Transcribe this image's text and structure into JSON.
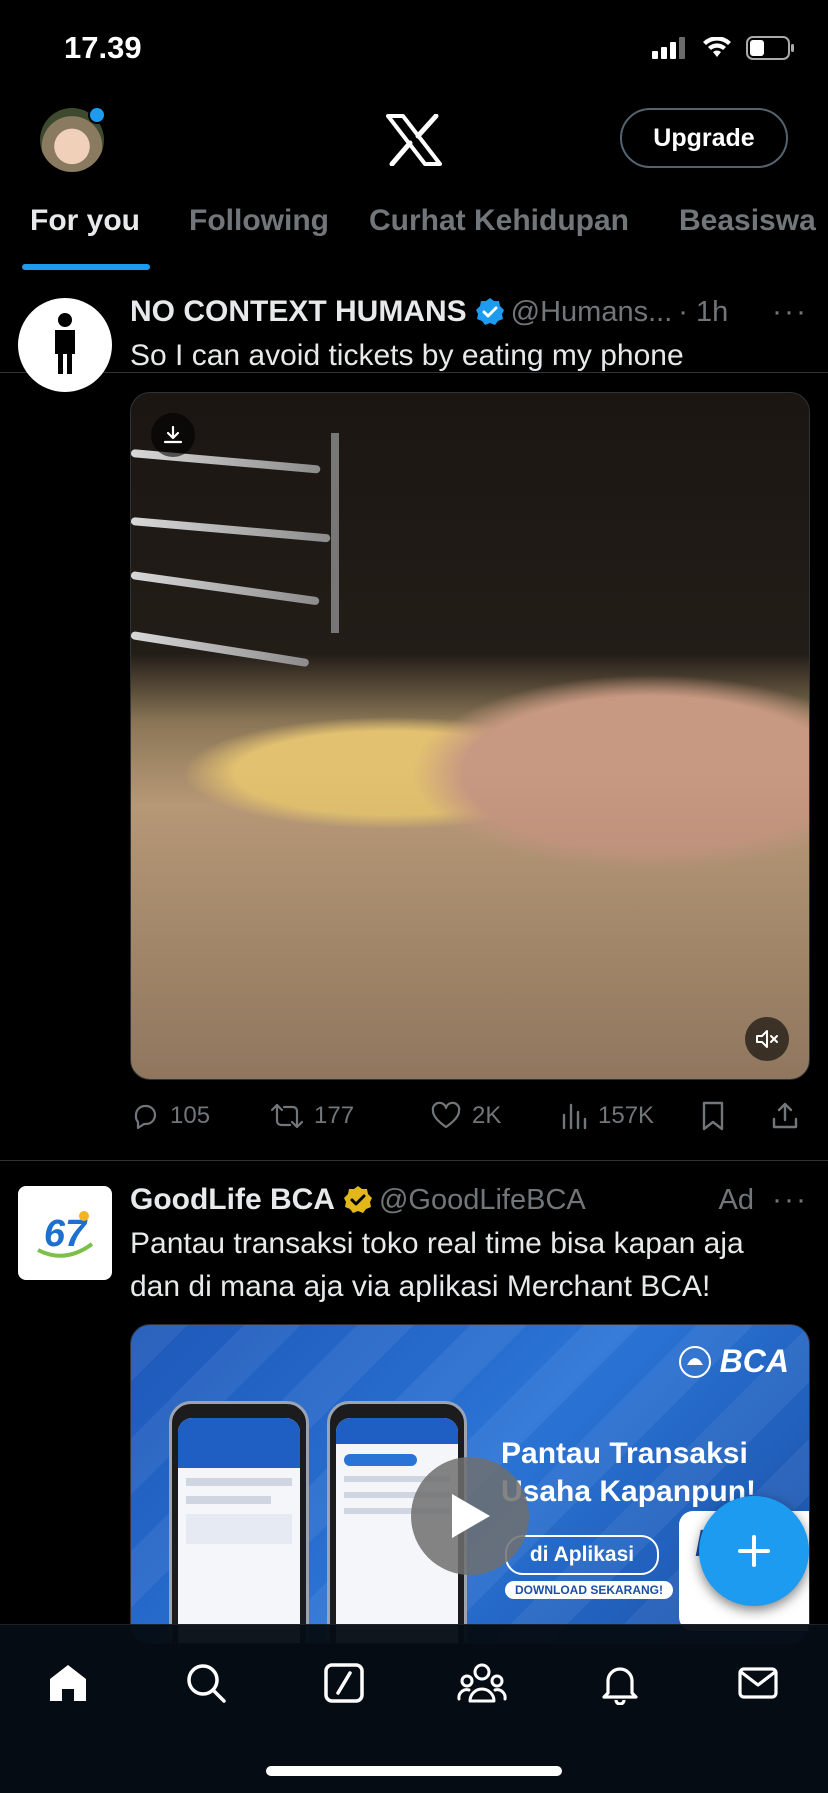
{
  "status_bar": {
    "time": "17.39"
  },
  "header": {
    "upgrade_label": "Upgrade"
  },
  "tabs": [
    {
      "label": "For you",
      "active": true
    },
    {
      "label": "Following"
    },
    {
      "label": "Curhat Kehidupan"
    },
    {
      "label": "Beasiswa"
    }
  ],
  "tweets": [
    {
      "name": "NO CONTEXT HUMANS",
      "handle": "@Humans...",
      "time": "· 1h",
      "more": "···",
      "text": "So I can avoid tickets by eating my phone",
      "stats": {
        "replies": "105",
        "reposts": "177",
        "likes": "2K",
        "views": "157K"
      }
    },
    {
      "name": "GoodLife BCA",
      "handle": "@GoodLifeBCA",
      "ad_label": "Ad",
      "more": "···",
      "text_line1": "Pantau transaksi toko real time bisa kapan aja",
      "text_line2": "dan di mana aja via aplikasi Merchant BCA!",
      "ad": {
        "logo": "BCA",
        "headline_line1": "Pantau Transaksi",
        "headline_line2": "Usaha Kapanpun!",
        "pill": "di Aplikasi",
        "download": "DOWNLOAD SEKARANG!",
        "card_text": "BC"
      }
    }
  ],
  "colors": {
    "accent": "#1d9bf0",
    "verified_gold": "#e2b719",
    "muted": "#71767b"
  },
  "icons": {
    "nav": [
      "home-icon",
      "search-icon",
      "grok-icon",
      "communities-icon",
      "notifications-icon",
      "messages-icon"
    ],
    "compose": "plus-icon"
  }
}
